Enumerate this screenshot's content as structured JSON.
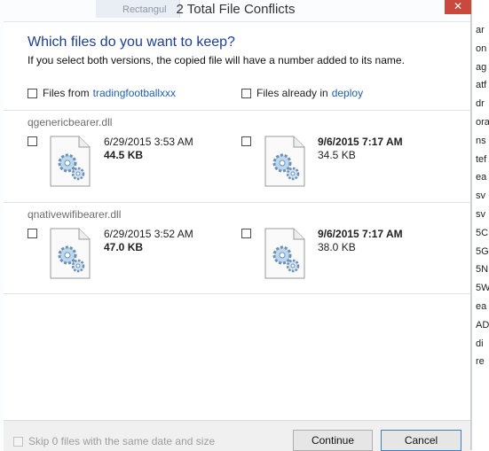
{
  "background": {
    "behind_tab": "Rectangul",
    "strip_fragments": [
      "ar",
      "on",
      "ag",
      "atf",
      "dr",
      "ora",
      "ns",
      "tef",
      "ea",
      "sv",
      "sv",
      "5C",
      "5G",
      "5N",
      "5W",
      "ea",
      "AD",
      "di",
      "re"
    ]
  },
  "dialog": {
    "title": "2 Total File Conflicts",
    "close_label": "✕",
    "question": "Which files do you want to keep?",
    "subtext": "If you select both versions, the copied file will have a number added to its name.",
    "options": {
      "from_prefix": "Files from ",
      "from_link": "tradingfootballxxx",
      "already_prefix": "Files already in ",
      "already_link": "deploy"
    },
    "files": [
      {
        "name": "qgenericbearer.dll",
        "source": {
          "date": "6/29/2015 3:53 AM",
          "size": "44.5 KB"
        },
        "dest": {
          "date": "9/6/2015 7:17 AM",
          "size": "34.5 KB"
        }
      },
      {
        "name": "qnativewifibearer.dll",
        "source": {
          "date": "6/29/2015 3:52 AM",
          "size": "47.0 KB"
        },
        "dest": {
          "date": "9/6/2015 7:17 AM",
          "size": "38.0 KB"
        }
      }
    ],
    "footer": {
      "skip_label": "Skip 0 files with the same date and size",
      "continue_label": "Continue",
      "cancel_label": "Cancel"
    }
  }
}
